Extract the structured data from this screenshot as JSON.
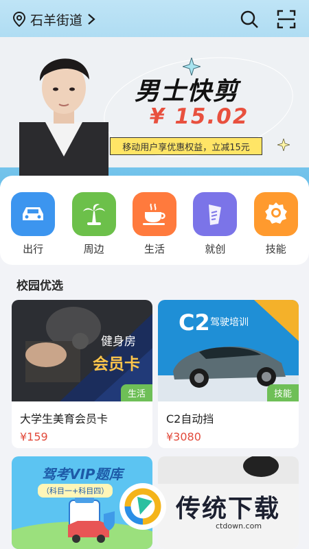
{
  "location": {
    "name": "石羊街道"
  },
  "banner": {
    "title": "男士快剪",
    "price": "¥ 15.02",
    "promo": "移动用户享优惠权益，立减15元"
  },
  "services": [
    {
      "label": "出行",
      "icon": "car-icon",
      "color": "#3c95ef"
    },
    {
      "label": "周边",
      "icon": "palm-tree-icon",
      "color": "#6cc04a"
    },
    {
      "label": "生活",
      "icon": "coffee-cup-icon",
      "color": "#ff7a3d"
    },
    {
      "label": "就创",
      "icon": "tie-icon",
      "color": "#7b74e8"
    },
    {
      "label": "技能",
      "icon": "medal-icon",
      "color": "#ff9a2e"
    }
  ],
  "section": {
    "title": "校园优选"
  },
  "cards": [
    {
      "name": "大学生美育会员卡",
      "price": "¥159",
      "tag": "生活",
      "img_line1": "健身房",
      "img_line2": "会员卡"
    },
    {
      "name": "C2自动挡",
      "price": "¥3080",
      "tag": "技能",
      "img_line1": "C2",
      "img_line2": "驾驶培训"
    },
    {
      "name": "",
      "price": "",
      "tag": "",
      "img_line1": "驾考VIP题库",
      "img_line2": "（科目一+科目四）"
    }
  ],
  "watermark": {
    "text": "传统下载",
    "sub": "ctdown.com"
  }
}
